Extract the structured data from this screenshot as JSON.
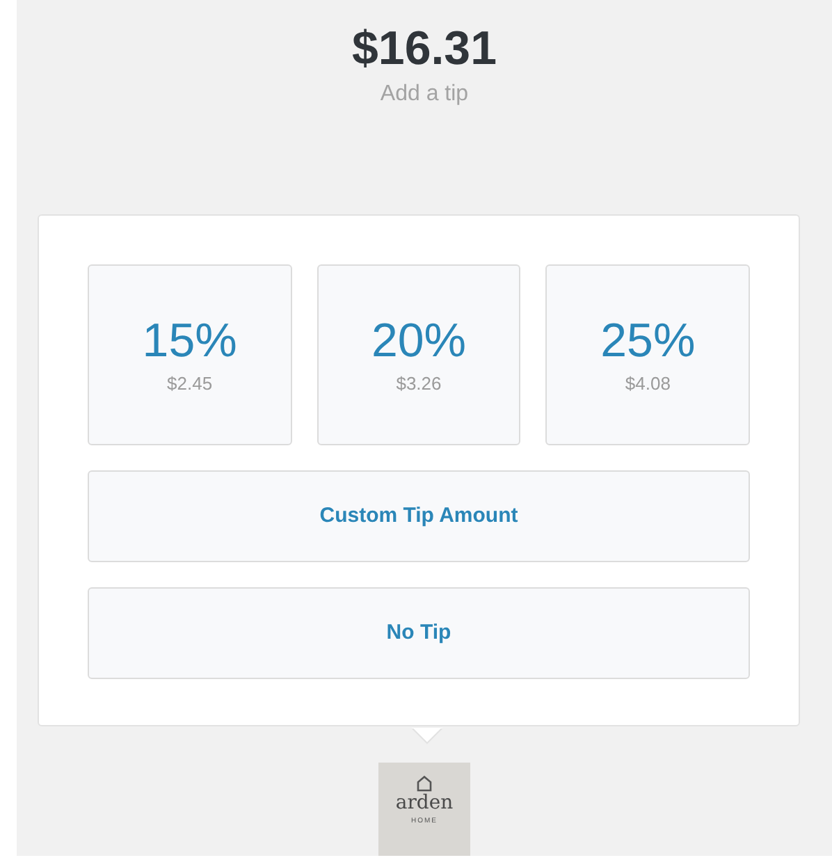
{
  "total": "$16.31",
  "subtitle": "Add a tip",
  "tip_options": [
    {
      "percent": "15%",
      "amount": "$2.45"
    },
    {
      "percent": "20%",
      "amount": "$3.26"
    },
    {
      "percent": "25%",
      "amount": "$4.08"
    }
  ],
  "buttons": [
    "Custom Tip Amount",
    "No Tip"
  ],
  "logo": {
    "name": "arden",
    "tagline": "HOME"
  }
}
